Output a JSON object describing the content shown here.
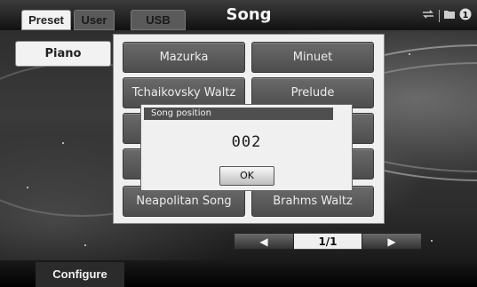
{
  "header": {
    "tabs": [
      {
        "label": "Preset",
        "active": true
      },
      {
        "label": "User",
        "active": false
      },
      {
        "label": "USB",
        "active": false
      }
    ],
    "title": "Song",
    "indicators": {
      "repeat_icon": "repeat-icon",
      "folder_icon": "folder-icon",
      "badge": "1"
    }
  },
  "category": {
    "label": "Piano"
  },
  "songs": [
    "Mazurka",
    "Minuet",
    "Tchaikovsky Waltz",
    "Prelude",
    "",
    "",
    "",
    "",
    "Neapolitan Song",
    "Brahms Waltz"
  ],
  "dialog": {
    "title": "Song position",
    "value": "002",
    "ok_label": "OK"
  },
  "pager": {
    "prev_glyph": "◀",
    "page": "1/1",
    "next_glyph": "▶"
  },
  "footer": {
    "configure_label": "Configure"
  }
}
